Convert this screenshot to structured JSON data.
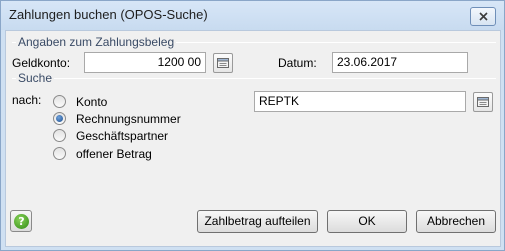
{
  "window": {
    "title": "Zahlungen buchen (OPOS-Suche)"
  },
  "payment_group": {
    "label": "Angaben zum Zahlungsbeleg",
    "geldkonto_label": "Geldkonto:",
    "geldkonto_value": "1200 00",
    "datum_label": "Datum:",
    "datum_value": "23.06.2017"
  },
  "search_group": {
    "label": "Suche",
    "nach_label": "nach:",
    "options": [
      {
        "label": "Konto",
        "checked": false
      },
      {
        "label": "Rechnungsnummer",
        "checked": true
      },
      {
        "label": "Geschäftspartner",
        "checked": false
      },
      {
        "label": "offener Betrag",
        "checked": false
      }
    ],
    "search_value": "REPTK"
  },
  "footer": {
    "help_symbol": "?",
    "split_label": "Zahlbetrag aufteilen",
    "ok_label": "OK",
    "cancel_label": "Abbrechen"
  },
  "icons": {
    "close": "close-icon",
    "picker": "picker-icon",
    "help": "help-icon"
  }
}
